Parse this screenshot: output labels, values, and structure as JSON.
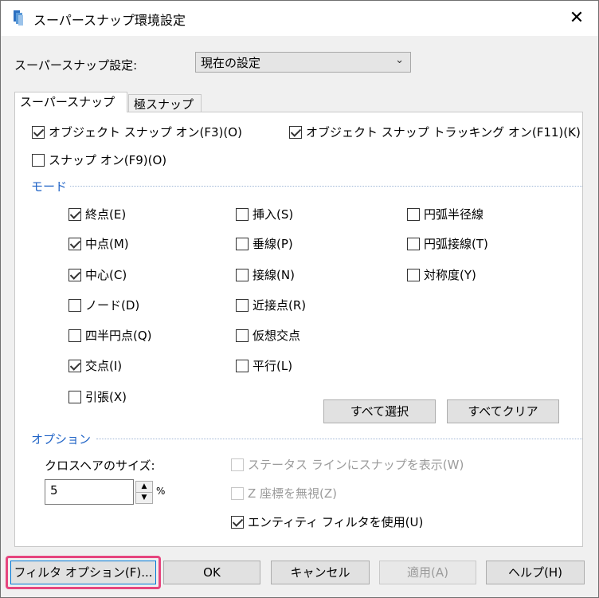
{
  "window": {
    "title": "スーパースナップ環境設定",
    "close_glyph": "✕"
  },
  "settings": {
    "label": "スーパースナップ設定:",
    "selected": "現在の設定",
    "arrow_glyph": "⌄"
  },
  "tabs": [
    {
      "label": "スーパースナップ",
      "active": true
    },
    {
      "label": "極スナップ",
      "active": false
    }
  ],
  "top_options": {
    "object_snap": {
      "label": "オブジェクト スナップ オン(F3)(O)",
      "checked": true
    },
    "object_tracking": {
      "label": "オブジェクト スナップ トラッキング オン(F11)(K)",
      "checked": true
    },
    "snap_on": {
      "label": "スナップ オン(F9)(O)",
      "checked": false
    }
  },
  "mode": {
    "label": "モード",
    "items": [
      {
        "label": "終点(E)",
        "checked": true
      },
      {
        "label": "中点(M)",
        "checked": true
      },
      {
        "label": "中心(C)",
        "checked": true
      },
      {
        "label": "ノード(D)",
        "checked": false
      },
      {
        "label": "四半円点(Q)",
        "checked": false
      },
      {
        "label": "交点(I)",
        "checked": true
      },
      {
        "label": "引張(X)",
        "checked": false
      },
      {
        "label": "挿入(S)",
        "checked": false
      },
      {
        "label": "垂線(P)",
        "checked": false
      },
      {
        "label": "接線(N)",
        "checked": false
      },
      {
        "label": "近接点(R)",
        "checked": false
      },
      {
        "label": "仮想交点",
        "checked": false
      },
      {
        "label": "平行(L)",
        "checked": false
      },
      {
        "label": "円弧半径線",
        "checked": false
      },
      {
        "label": "円弧接線(T)",
        "checked": false
      },
      {
        "label": "対称度(Y)",
        "checked": false
      }
    ],
    "select_all": "すべて選択",
    "clear_all": "すべてクリア"
  },
  "options": {
    "label": "オプション",
    "crosshair_label": "クロスヘアのサイズ:",
    "crosshair_value": "5",
    "crosshair_unit": "%",
    "status_line": {
      "label": "ステータス ラインにスナップを表示(W)",
      "checked": false,
      "disabled": true
    },
    "ignore_z": {
      "label": "Z 座標を無視(Z)",
      "checked": false,
      "disabled": true
    },
    "entity_filter": {
      "label": "エンティティ フィルタを使用(U)",
      "checked": true,
      "disabled": false
    }
  },
  "footer": {
    "filter_options": "フィルタ オプション(F)...",
    "ok": "OK",
    "cancel": "キャンセル",
    "apply": "適用(A)",
    "help": "ヘルプ(H)"
  },
  "colors": {
    "section_blue": "#1f63c6",
    "highlight_pink": "#e6457e"
  }
}
